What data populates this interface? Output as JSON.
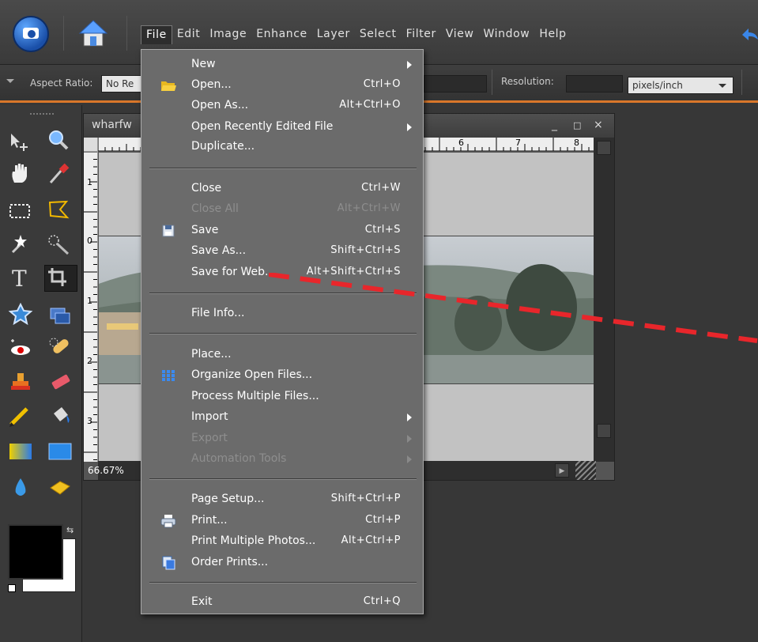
{
  "menubar": {
    "items": [
      "File",
      "Edit",
      "Image",
      "Enhance",
      "Layer",
      "Select",
      "Filter",
      "View",
      "Window",
      "Help"
    ]
  },
  "options_bar": {
    "aspect_ratio_label": "Aspect Ratio:",
    "aspect_ratio_value": "No Re",
    "resolution_label": "Resolution:",
    "resolution_value": "",
    "resolution_unit": "pixels/inch"
  },
  "document": {
    "title": "wharfw",
    "zoom": "66.67%",
    "ruler_top_numbers": [
      "6",
      "7",
      "8"
    ],
    "ruler_left_numbers": [
      "1",
      "0",
      "1",
      "2",
      "3"
    ],
    "window_controls": [
      "_",
      "□",
      "×"
    ]
  },
  "file_menu": {
    "items": [
      {
        "label": "New",
        "shortcut": "",
        "submenu": true,
        "disabled": false,
        "icon": ""
      },
      {
        "label": "Open...",
        "shortcut": "Ctrl+O",
        "submenu": false,
        "disabled": false,
        "icon": "folder-icon"
      },
      {
        "label": "Open As...",
        "shortcut": "Alt+Ctrl+O",
        "submenu": false,
        "disabled": false,
        "icon": ""
      },
      {
        "label": "Open Recently Edited File",
        "shortcut": "",
        "submenu": true,
        "disabled": false,
        "icon": ""
      },
      {
        "label": "Duplicate...",
        "shortcut": "",
        "submenu": false,
        "disabled": false,
        "icon": ""
      },
      {
        "label": "Close",
        "shortcut": "Ctrl+W",
        "submenu": false,
        "disabled": false,
        "icon": ""
      },
      {
        "label": "Close All",
        "shortcut": "Alt+Ctrl+W",
        "submenu": false,
        "disabled": true,
        "icon": ""
      },
      {
        "label": "Save",
        "shortcut": "Ctrl+S",
        "submenu": false,
        "disabled": false,
        "icon": "floppy-disk-icon"
      },
      {
        "label": "Save As...",
        "shortcut": "Shift+Ctrl+S",
        "submenu": false,
        "disabled": false,
        "icon": ""
      },
      {
        "label": "Save for Web...",
        "shortcut": "Alt+Shift+Ctrl+S",
        "submenu": false,
        "disabled": false,
        "icon": ""
      },
      {
        "label": "File Info...",
        "shortcut": "",
        "submenu": false,
        "disabled": false,
        "icon": ""
      },
      {
        "label": "Place...",
        "shortcut": "",
        "submenu": false,
        "disabled": false,
        "icon": ""
      },
      {
        "label": "Organize Open Files...",
        "shortcut": "",
        "submenu": false,
        "disabled": false,
        "icon": "grid-icon"
      },
      {
        "label": "Process Multiple Files...",
        "shortcut": "",
        "submenu": false,
        "disabled": false,
        "icon": ""
      },
      {
        "label": "Import",
        "shortcut": "",
        "submenu": true,
        "disabled": false,
        "icon": ""
      },
      {
        "label": "Export",
        "shortcut": "",
        "submenu": true,
        "disabled": true,
        "icon": ""
      },
      {
        "label": "Automation Tools",
        "shortcut": "",
        "submenu": true,
        "disabled": true,
        "icon": ""
      },
      {
        "label": "Page Setup...",
        "shortcut": "Shift+Ctrl+P",
        "submenu": false,
        "disabled": false,
        "icon": ""
      },
      {
        "label": "Print...",
        "shortcut": "Ctrl+P",
        "submenu": false,
        "disabled": false,
        "icon": "printer-icon"
      },
      {
        "label": "Print Multiple Photos...",
        "shortcut": "Alt+Ctrl+P",
        "submenu": false,
        "disabled": false,
        "icon": ""
      },
      {
        "label": "Order Prints...",
        "shortcut": "",
        "submenu": false,
        "disabled": false,
        "icon": "order-prints-icon"
      },
      {
        "label": "Exit",
        "shortcut": "Ctrl+Q",
        "submenu": false,
        "disabled": false,
        "icon": ""
      }
    ]
  },
  "colors": {
    "accent_orange": "#d9772a",
    "annotation_red": "#e8262b",
    "menu_bg": "#6b6b6b"
  }
}
